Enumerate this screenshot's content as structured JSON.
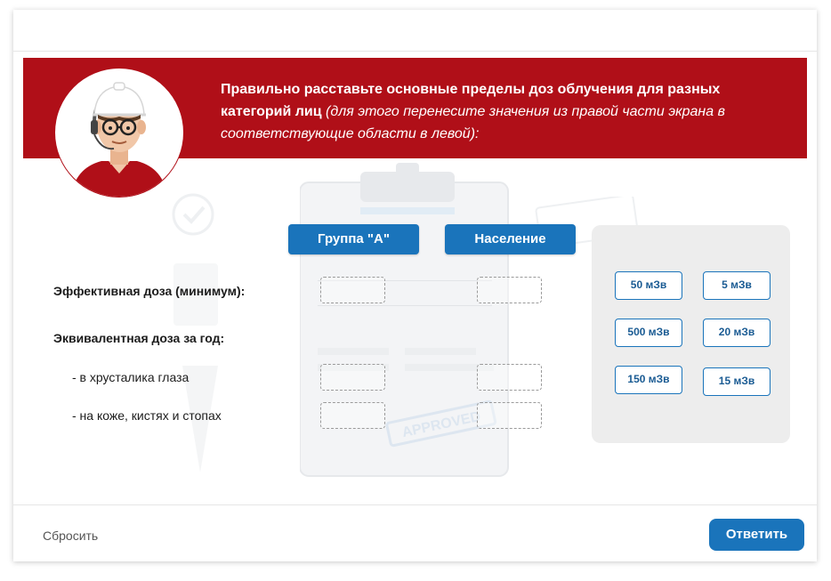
{
  "banner": {
    "title_bold": "Правильно расставьте основные пределы доз облучения для разных категорий лиц",
    "title_italic": " (для этого перенесите значения из правой части экрана в соответствующие области в левой):"
  },
  "columns": [
    "Группа \"А\"",
    "Население"
  ],
  "rows": {
    "effective": "Эффективная доза (минимум):",
    "equivalent": "Эквивалентная доза за год:",
    "lens": "- в хрусталика глаза",
    "skin": "- на коже, кистях и стопах"
  },
  "options": [
    "50 мЗв",
    "5 мЗв",
    "500 мЗв",
    "20 мЗв",
    "150 мЗв",
    "15 мЗв"
  ],
  "decor": {
    "stamp": "APPROVED"
  },
  "footer": {
    "reset_label": "Сбросить",
    "submit_label": "Ответить"
  },
  "colors": {
    "banner": "#b00f18",
    "accent": "#1a74bb",
    "panel": "#ededed"
  }
}
